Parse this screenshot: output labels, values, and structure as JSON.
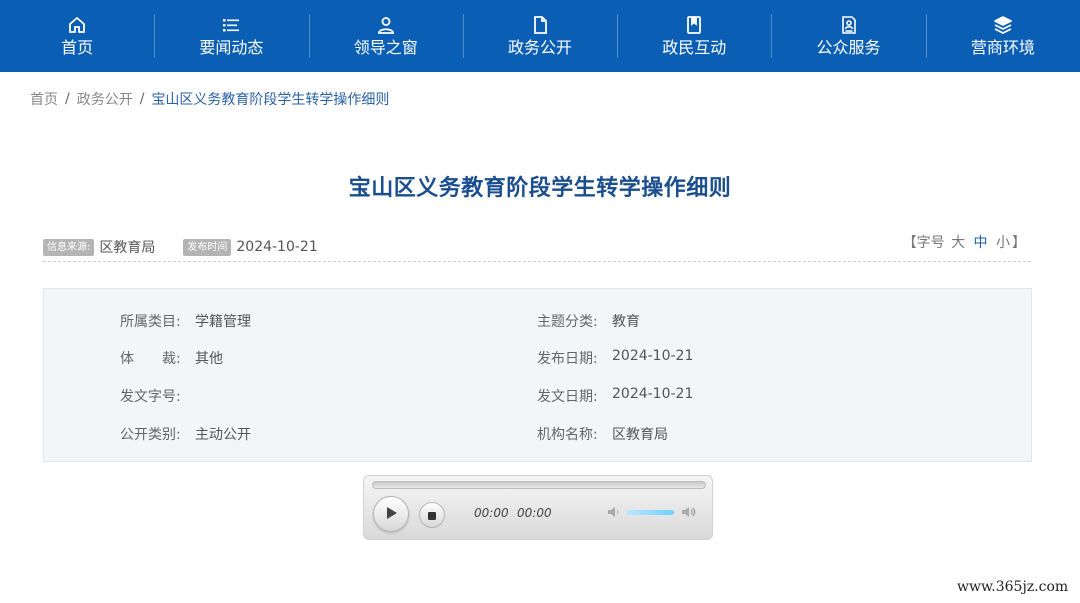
{
  "nav": {
    "items": [
      {
        "label": "首页",
        "icon": "home-icon"
      },
      {
        "label": "要闻动态",
        "icon": "list-icon"
      },
      {
        "label": "领导之窗",
        "icon": "user-icon"
      },
      {
        "label": "政务公开",
        "icon": "document-icon"
      },
      {
        "label": "政民互动",
        "icon": "bookmark-icon"
      },
      {
        "label": "公众服务",
        "icon": "service-icon"
      },
      {
        "label": "营商环境",
        "icon": "layers-icon"
      }
    ],
    "bg_color": "#0a5fb4"
  },
  "breadcrumb": {
    "items": [
      "首页",
      "政务公开"
    ],
    "separator": "/",
    "current": "宝山区义务教育阶段学生转学操作细则"
  },
  "article": {
    "title": "宝山区义务教育阶段学生转学操作细则",
    "source_tag": "信息来源:",
    "source": "区教育局",
    "date_tag": "发布时间",
    "date": "2024-10-21",
    "fontsize": {
      "open": "【字号",
      "large": "大",
      "medium": "中",
      "small": "小",
      "close": "】"
    }
  },
  "info": {
    "category_label": "所属类目:",
    "category": "学籍管理",
    "topic_label": "主题分类:",
    "topic": "教育",
    "genre_label": "体　　裁:",
    "genre": "其他",
    "publish_date_label": "发布日期:",
    "publish_date": "2024-10-21",
    "doc_no_label": "发文字号:",
    "doc_no": "",
    "issue_date_label": "发文日期:",
    "issue_date": "2024-10-21",
    "open_type_label": "公开类别:",
    "open_type": "主动公开",
    "org_label": "机构名称:",
    "org": "区教育局"
  },
  "player": {
    "current_time": "00:00",
    "duration": "00:00",
    "progress": 0,
    "volume": 0.8
  },
  "watermark": "www.365jz.com",
  "colors": {
    "accent": "#1b4e8f",
    "link": "#2b62a8"
  }
}
